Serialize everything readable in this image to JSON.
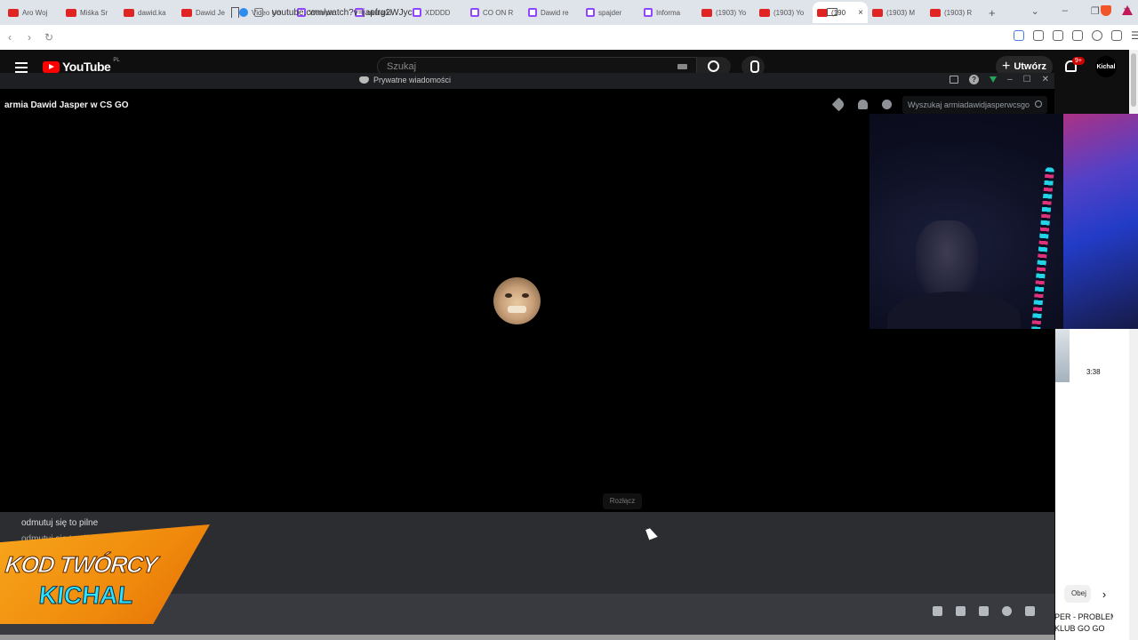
{
  "browser": {
    "tabs": [
      {
        "icon": "youtube-icon",
        "label": "Aro Woj"
      },
      {
        "icon": "youtube-icon",
        "label": "Miśka Sr"
      },
      {
        "icon": "youtube-icon",
        "label": "dawid.ka"
      },
      {
        "icon": "youtube-icon",
        "label": "Dawid Je"
      },
      {
        "icon": "video-icon",
        "label": "Video Un"
      },
      {
        "icon": "twitch-icon",
        "label": "Wampir"
      },
      {
        "icon": "twitch-icon",
        "label": "okularki"
      },
      {
        "icon": "twitch-icon",
        "label": "XDDDD"
      },
      {
        "icon": "twitch-icon",
        "label": "CO ON R"
      },
      {
        "icon": "twitch-icon",
        "label": "Dawid re"
      },
      {
        "icon": "twitch-icon",
        "label": "spajder"
      },
      {
        "icon": "twitch-icon",
        "label": "Informa"
      },
      {
        "icon": "youtube-icon",
        "label": "(1903) Yo"
      },
      {
        "icon": "youtube-icon",
        "label": "(1903) Yo"
      },
      {
        "icon": "youtube-icon",
        "label": "(190",
        "active": true
      },
      {
        "icon": "youtube-icon",
        "label": "(1903) M"
      },
      {
        "icon": "youtube-icon",
        "label": "(1903) R"
      }
    ],
    "new_tab": "+",
    "url": "youtube.com/watch?v=japfrg2WJyc"
  },
  "youtube": {
    "logo": "YouTube",
    "country": "PL",
    "search_placeholder": "Szukaj",
    "create_label": "Utwórz",
    "notifications_badge": "9+",
    "avatar_text": "Kichal",
    "recommended": {
      "duration": "3:38",
      "chip": "Obej",
      "title": "PER - PROBLEM\nKLUB GO GO"
    }
  },
  "discord": {
    "window_title": "Prywatne wiadomości",
    "channel_name": "armia Dawid Jasper w CS GO",
    "search_placeholder": "Wyszukaj armiadawidjasperwcsgo",
    "tooltip": "Rozłącz",
    "messages": [
      {
        "text": "odmutuj się to pilne"
      },
      {
        "text": "odmutuj się to pilne"
      }
    ]
  },
  "overlay": {
    "line1": "KOD TWÓRCY",
    "line2": "KICHAL"
  },
  "colors": {
    "hangup": "#da373c",
    "youtube_red": "#ff0000",
    "overlay_orange": "#f7a51c",
    "overlay_cyan": "#2de3ff"
  }
}
